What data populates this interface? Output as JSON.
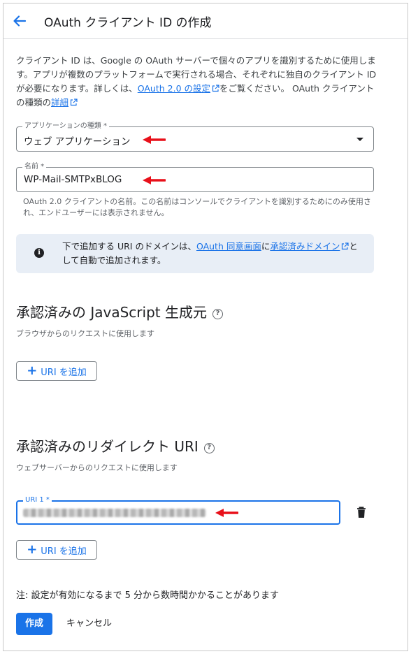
{
  "header": {
    "title": "OAuth クライアント ID の作成"
  },
  "intro": {
    "text_1": "クライアント ID は、Google の OAuth サーバーで個々のアプリを識別するために使用します。アプリが複数のプラットフォームで実行される場合、それぞれに独自のクライアント ID が必要になります。詳しくは、",
    "link_1": "OAuth 2.0 の設定",
    "text_2": "をご覧ください。 OAuth クライアントの種類の",
    "link_2": "詳細"
  },
  "app_type": {
    "label": "アプリケーションの種類 *",
    "value": "ウェブ アプリケーション"
  },
  "name": {
    "label": "名前 *",
    "value": "WP-Mail-SMTPxBLOG",
    "hint": "OAuth 2.0 クライアントの名前。この名前はコンソールでクライアントを識別するためにのみ使用され、エンドユーザーには表示されません。"
  },
  "info": {
    "icon": "info-icon",
    "text_1": "下で追加する URI のドメインは、",
    "link_1": "OAuth 同意画面",
    "text_2": "に",
    "link_2": "承認済みドメイン",
    "text_3": "として自動で追加されます。"
  },
  "js_origins": {
    "title": "承認済みの JavaScript 生成元",
    "subtitle": "ブラウザからのリクエストに使用します",
    "add_label": "URI を追加"
  },
  "redirect_uris": {
    "title": "承認済みのリダイレクト URI",
    "subtitle": "ウェブサーバーからのリクエストに使用します",
    "uri_label": "URI 1 *",
    "add_label": "URI を追加"
  },
  "footer": {
    "note": "注: 設定が有効になるまで 5 分から数時間かかることがあります",
    "create_label": "作成",
    "cancel_label": "キャンセル"
  },
  "colors": {
    "accent": "#1a73e8",
    "annotation_arrow": "#e8101a",
    "info_bg": "#e8eef6"
  }
}
